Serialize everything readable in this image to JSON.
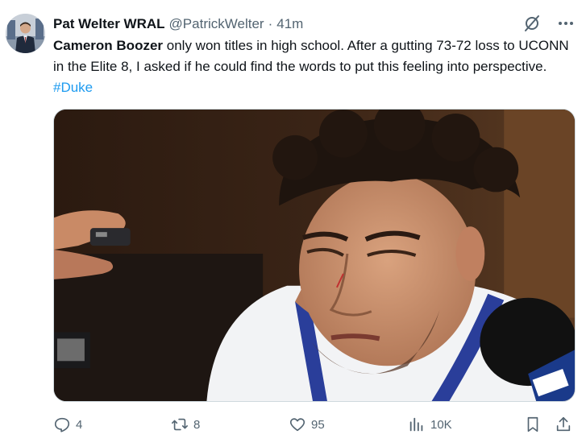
{
  "author": {
    "display_name": "Pat Welter WRAL",
    "handle": "@PatrickWelter",
    "separator": "·",
    "timestamp": "41m",
    "avatar_icon": "profile-photo"
  },
  "header_icons": {
    "grok": "grok-icon",
    "more": "more-icon"
  },
  "tweet": {
    "text_bold": "Cameron Boozer",
    "text_main": " only won titles in high school.  After a gutting 73-72 loss to UCONN in the Elite 8, I asked if he could find the words to put this feeling into perspective.  ",
    "hashtag": "#Duke"
  },
  "media": {
    "type": "video-still",
    "description_icon": "media-image"
  },
  "actions": {
    "replies": "4",
    "retweets": "8",
    "likes": "95",
    "views": "10K"
  },
  "colors": {
    "link": "#1d9bf0",
    "secondary_text": "#536471",
    "primary_text": "#0f1419"
  }
}
